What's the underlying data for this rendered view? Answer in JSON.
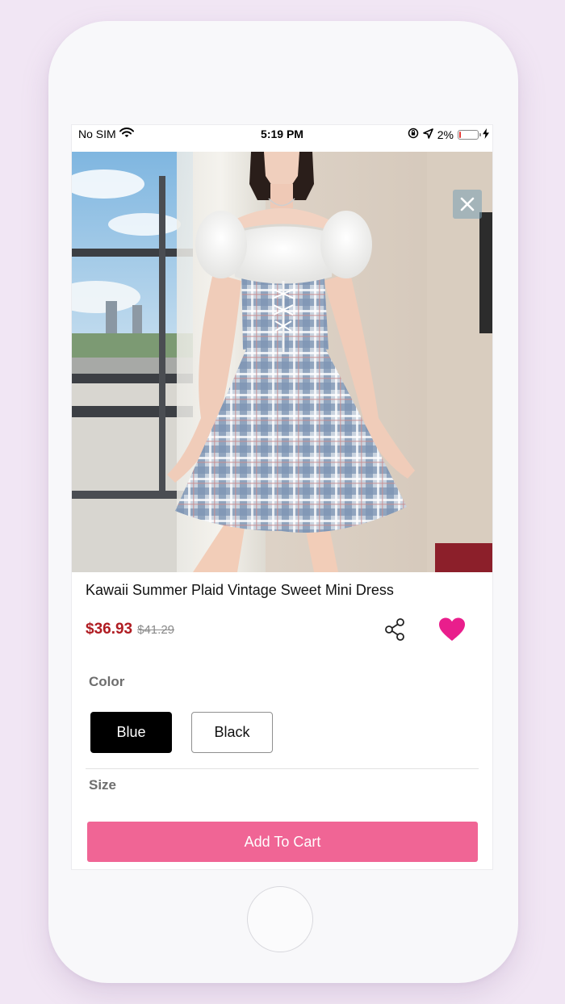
{
  "status_bar": {
    "carrier": "No SIM",
    "time": "5:19 PM",
    "battery_percent": "2%",
    "icons": [
      "wifi-icon",
      "orientation-lock-icon",
      "location-arrow-icon",
      "battery-icon",
      "charging-bolt-icon"
    ]
  },
  "gallery": {
    "close_icon": "close-icon",
    "dot_count": 8,
    "active_dot": 0
  },
  "product": {
    "title": "Kawaii Summer Plaid Vintage Sweet Mini Dress",
    "price": "$36.93",
    "original_price": "$41.29",
    "share_icon": "share-icon",
    "favorite_icon": "heart-icon"
  },
  "options": {
    "color_label": "Color",
    "colors": [
      {
        "label": "Blue",
        "selected": true
      },
      {
        "label": "Black",
        "selected": false
      }
    ],
    "size_label": "Size"
  },
  "cart": {
    "button_label": "Add To Cart"
  },
  "colors": {
    "accent_pink": "#f06595",
    "favorite_pink": "#e91e8c",
    "price_red": "#b01c22",
    "background": "#f1e6f4"
  }
}
